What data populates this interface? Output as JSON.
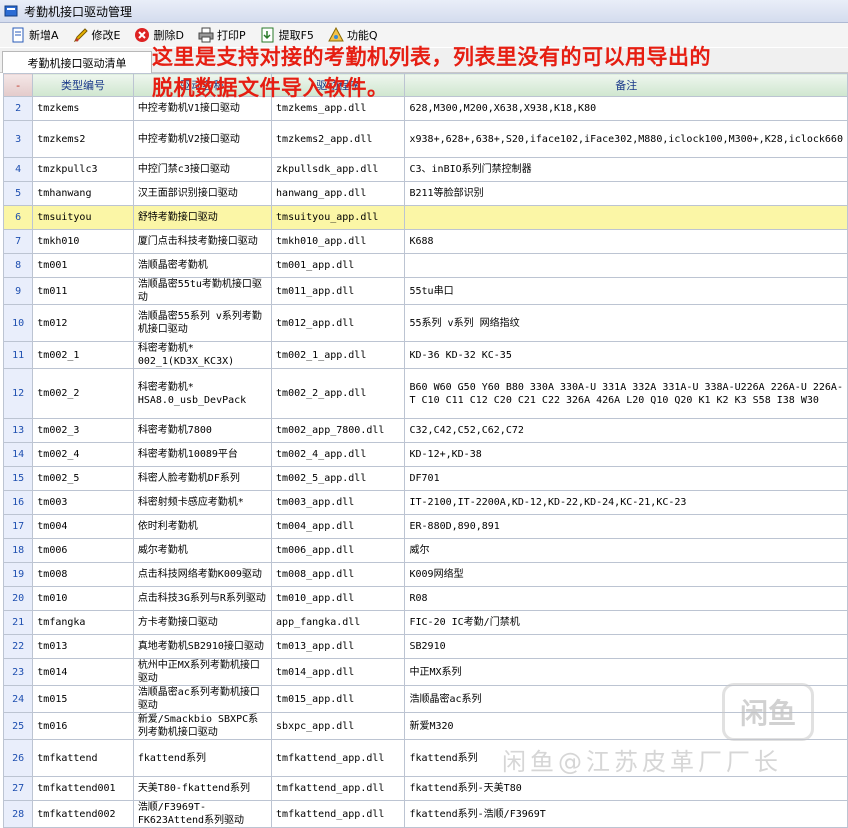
{
  "window": {
    "title": "考勤机接口驱动管理"
  },
  "toolbar": [
    {
      "label": "新增A",
      "icon": "new-icon"
    },
    {
      "label": "修改E",
      "icon": "edit-icon"
    },
    {
      "label": "删除D",
      "icon": "delete-icon"
    },
    {
      "label": "打印P",
      "icon": "printer-icon"
    },
    {
      "label": "提取F5",
      "icon": "extract-icon"
    },
    {
      "label": "功能Q",
      "icon": "function-icon"
    }
  ],
  "tab": {
    "label": "考勤机接口驱动清单"
  },
  "overlay": {
    "line1": "这里是支持对接的考勤机列表，列表里没有的可以用导出的",
    "line2": "脱机数据文件导入软件。"
  },
  "table": {
    "columns": [
      "-",
      "类型编号",
      "驱动名称",
      "驱动程序",
      "备注"
    ],
    "rows": [
      [
        "2",
        "tmzkems",
        "中控考勤机V1接口驱动",
        "tmzkems_app.dll",
        "628,M300,M200,X638,X938,K18,K80"
      ],
      [
        "3",
        "tmzkems2",
        "中控考勤机V2接口驱动",
        "tmzkems2_app.dll",
        "x938+,628+,638+,S20,iface102,iFace302,M880,iclock100,M300+,K28,iclock660"
      ],
      [
        "4",
        "tmzkpullc3",
        "中控门禁c3接口驱动",
        "zkpullsdk_app.dll",
        "C3、inBIO系列门禁控制器"
      ],
      [
        "5",
        "tmhanwang",
        "汉王面部识别接口驱动",
        "hanwang_app.dll",
        "B211等脸部识别"
      ],
      [
        "6",
        "tmsuityou",
        "舒特考勤接口驱动",
        "tmsuityou_app.dll",
        ""
      ],
      [
        "7",
        "tmkh010",
        "厦门点击科技考勤接口驱动",
        "tmkh010_app.dll",
        "K688"
      ],
      [
        "8",
        "tm001",
        "浩顺晶密考勤机",
        "tm001_app.dll",
        ""
      ],
      [
        "9",
        "tm011",
        "浩顺晶密55tu考勤机接口驱动",
        "tm011_app.dll",
        "55tu串口"
      ],
      [
        "10",
        "tm012",
        "浩顺晶密55系列 v系列考勤机接口驱动",
        "tm012_app.dll",
        "55系列 v系列 网络指纹"
      ],
      [
        "11",
        "tm002_1",
        "科密考勤机* 002_1(KD3X_KC3X)",
        "tm002_1_app.dll",
        "KD-36 KD-32 KC-35"
      ],
      [
        "12",
        "tm002_2",
        "科密考勤机* HSA8.0_usb_DevPack",
        "tm002_2_app.dll",
        "B60 W60 G50 Y60 B80 330A 330A-U 331A 332A 331A-U 338A-U226A 226A-U 226A-T C10 C11 C12 C20 C21 C22 326A 426A L20 Q10 Q20 K1 K2 K3 S58 I38 W30"
      ],
      [
        "13",
        "tm002_3",
        "科密考勤机7800",
        "tm002_app_7800.dll",
        "C32,C42,C52,C62,C72"
      ],
      [
        "14",
        "tm002_4",
        "科密考勤机10089平台",
        "tm002_4_app.dll",
        "KD-12+,KD-38"
      ],
      [
        "15",
        "tm002_5",
        "科密人脸考勤机DF系列",
        "tm002_5_app.dll",
        "DF701"
      ],
      [
        "16",
        "tm003",
        "科密射频卡感应考勤机*",
        "tm003_app.dll",
        "IT-2100,IT-2200A,KD-12,KD-22,KD-24,KC-21,KC-23"
      ],
      [
        "17",
        "tm004",
        "依时利考勤机",
        "tm004_app.dll",
        "ER-880D,890,891"
      ],
      [
        "18",
        "tm006",
        "威尔考勤机",
        "tm006_app.dll",
        "威尔"
      ],
      [
        "19",
        "tm008",
        "点击科技网络考勤K009驱动",
        "tm008_app.dll",
        "K009网络型"
      ],
      [
        "20",
        "tm010",
        "点击科技3G系列与R系列驱动",
        "tm010_app.dll",
        "R08"
      ],
      [
        "21",
        "tmfangka",
        "方卡考勤接口驱动",
        "app_fangka.dll",
        "FIC-20 IC考勤/门禁机"
      ],
      [
        "22",
        "tm013",
        "真地考勤机SB2910接口驱动",
        "tm013_app.dll",
        "SB2910"
      ],
      [
        "23",
        "tm014",
        "杭州中正MX系列考勤机接口驱动",
        "tm014_app.dll",
        "中正MX系列"
      ],
      [
        "24",
        "tm015",
        "浩顺晶密ac系列考勤机接口驱动",
        "tm015_app.dll",
        "浩顺晶密ac系列"
      ],
      [
        "25",
        "tm016",
        "新爱/Smackbio SBXPC系列考勤机接口驱动",
        "sbxpc_app.dll",
        "新爱M320"
      ],
      [
        "26",
        "tmfkattend",
        "fkattend系列",
        "tmfkattend_app.dll",
        "fkattend系列"
      ],
      [
        "27",
        "tmfkattend001",
        "天美T80-fkattend系列",
        "tmfkattend_app.dll",
        "fkattend系列-天美T80"
      ],
      [
        "28",
        "tmfkattend002",
        "浩顺/F3969T-FK623Attend系列驱动",
        "tmfkattend_app.dll",
        "fkattend系列-浩顺/F3969T"
      ]
    ],
    "selected_row": "6"
  },
  "watermarks": {
    "logo": "闲鱼",
    "caption": "闲鱼@江苏皮革厂厂长"
  },
  "colors": {
    "overlay_text": "#e61e12",
    "selected_row": "#fbf6a6",
    "header_text": "#1a3a8a"
  }
}
